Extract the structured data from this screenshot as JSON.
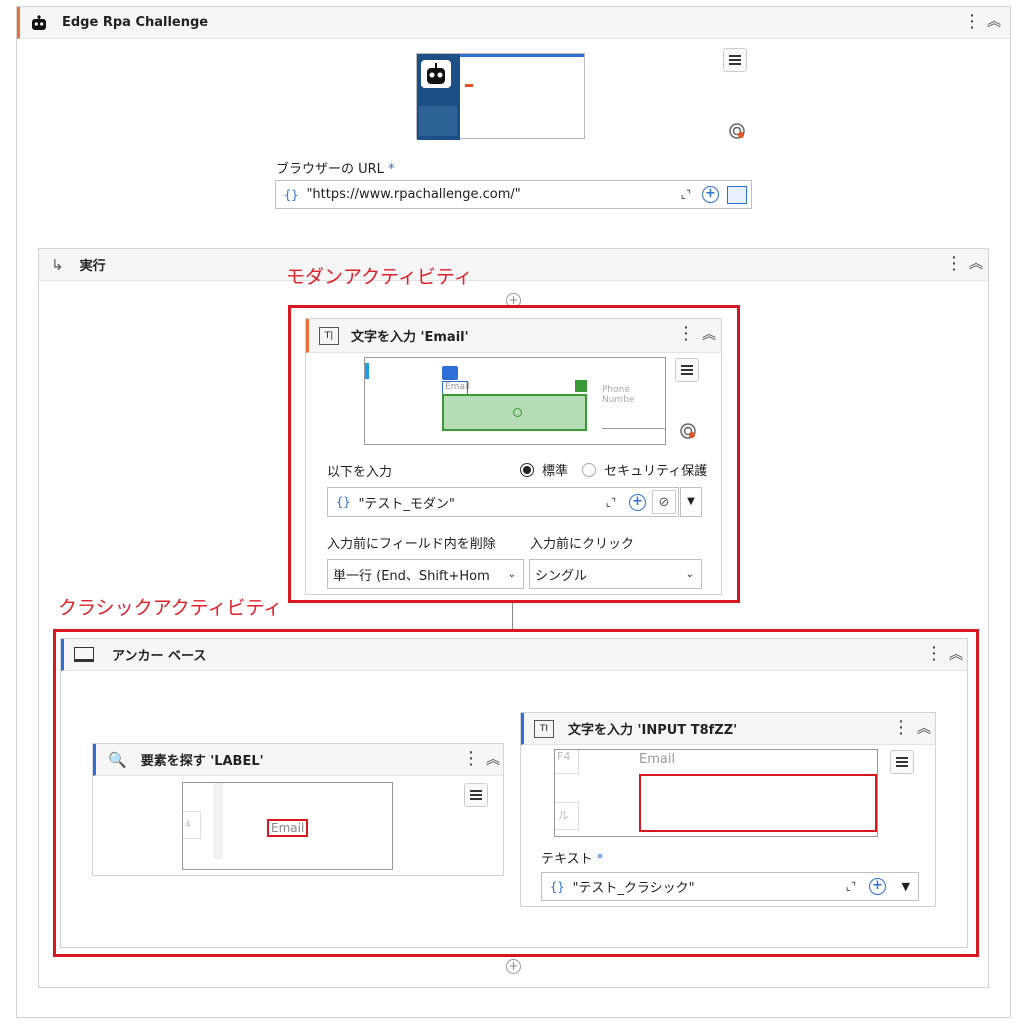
{
  "app": {
    "title": "Edge Rpa Challenge"
  },
  "browser": {
    "url_label": "ブラウザーの URL",
    "required_mark": "*",
    "url_value": "\"https://www.rpachallenge.com/\"",
    "curly": "{}"
  },
  "do_block": {
    "title": "実行"
  },
  "annotations": {
    "modern": "モダンアクティビティ",
    "classic": "クラシックアクティビティ"
  },
  "type_into_email": {
    "title": "文字を入力 'Email'",
    "preview_email": "Email",
    "preview_phone": "Phone Numbe",
    "input_label": "以下を入力",
    "radio_standard": "標準",
    "radio_secure": "セキュリティ保護",
    "input_value": "\"テスト_モダン\"",
    "empty_field_label": "入力前にフィールド内を削除",
    "empty_field_value": "単一行 (End、Shift+Hom",
    "click_before_label": "入力前にクリック",
    "click_before_value": "シングル"
  },
  "anchor_base": {
    "title": "アンカー ベース"
  },
  "find_element": {
    "title": "要素を探す 'LABEL'",
    "preview_label": "Email",
    "preview_side": "4"
  },
  "type_into_classic": {
    "title": "文字を入力 'INPUT  T8fZZ'",
    "preview_email": "Email",
    "preview_f4": "F4",
    "preview_ru": "ル",
    "text_label": "テキスト",
    "required_mark": "*",
    "text_value": "\"テスト_クラシック\""
  },
  "colors": {
    "accent_orange": "#e8703a",
    "accent_blue": "#2f6fd8",
    "annotation_red": "#d7191f"
  }
}
